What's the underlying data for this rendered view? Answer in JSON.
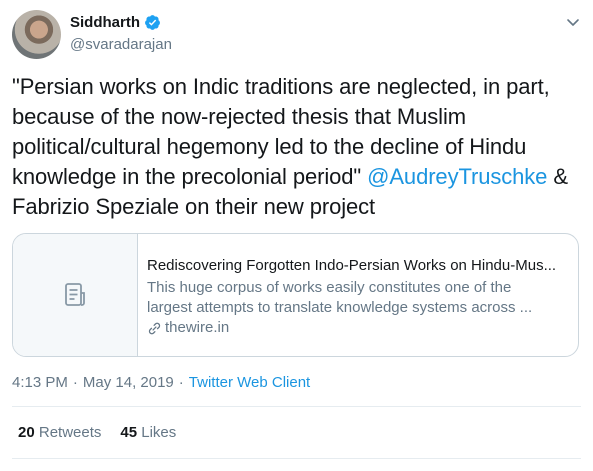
{
  "author": {
    "name": "Siddharth",
    "handle": "@svaradarajan",
    "verified": true
  },
  "tweet": {
    "text_before": "\"Persian works on Indic traditions are neglected, in part, because of the now-rejected thesis that Muslim political/cultural hegemony led to the decline of Hindu knowledge in the precolonial period\" ",
    "mention": "@AudreyTruschke",
    "text_after": " & Fabrizio Speziale on their new project"
  },
  "card": {
    "title": "Rediscovering Forgotten Indo-Persian Works on Hindu-Mus...",
    "description_lines": [
      "This huge corpus of works easily constitutes one of the",
      "largest attempts to translate knowledge systems across ..."
    ],
    "domain": "thewire.in"
  },
  "meta": {
    "time": "4:13 PM",
    "separator": "·",
    "date": "May 14, 2019",
    "source": "Twitter Web Client"
  },
  "stats": {
    "retweets_count": "20",
    "retweets_label": "Retweets",
    "likes_count": "45",
    "likes_label": "Likes"
  },
  "colors": {
    "accent": "#1b95e0",
    "muted": "#657786",
    "border": "#ccd6dd"
  },
  "icons": {
    "verified": "verified-badge-icon",
    "caret": "chevron-down-icon",
    "card_placeholder": "document-icon",
    "link": "link-icon"
  }
}
